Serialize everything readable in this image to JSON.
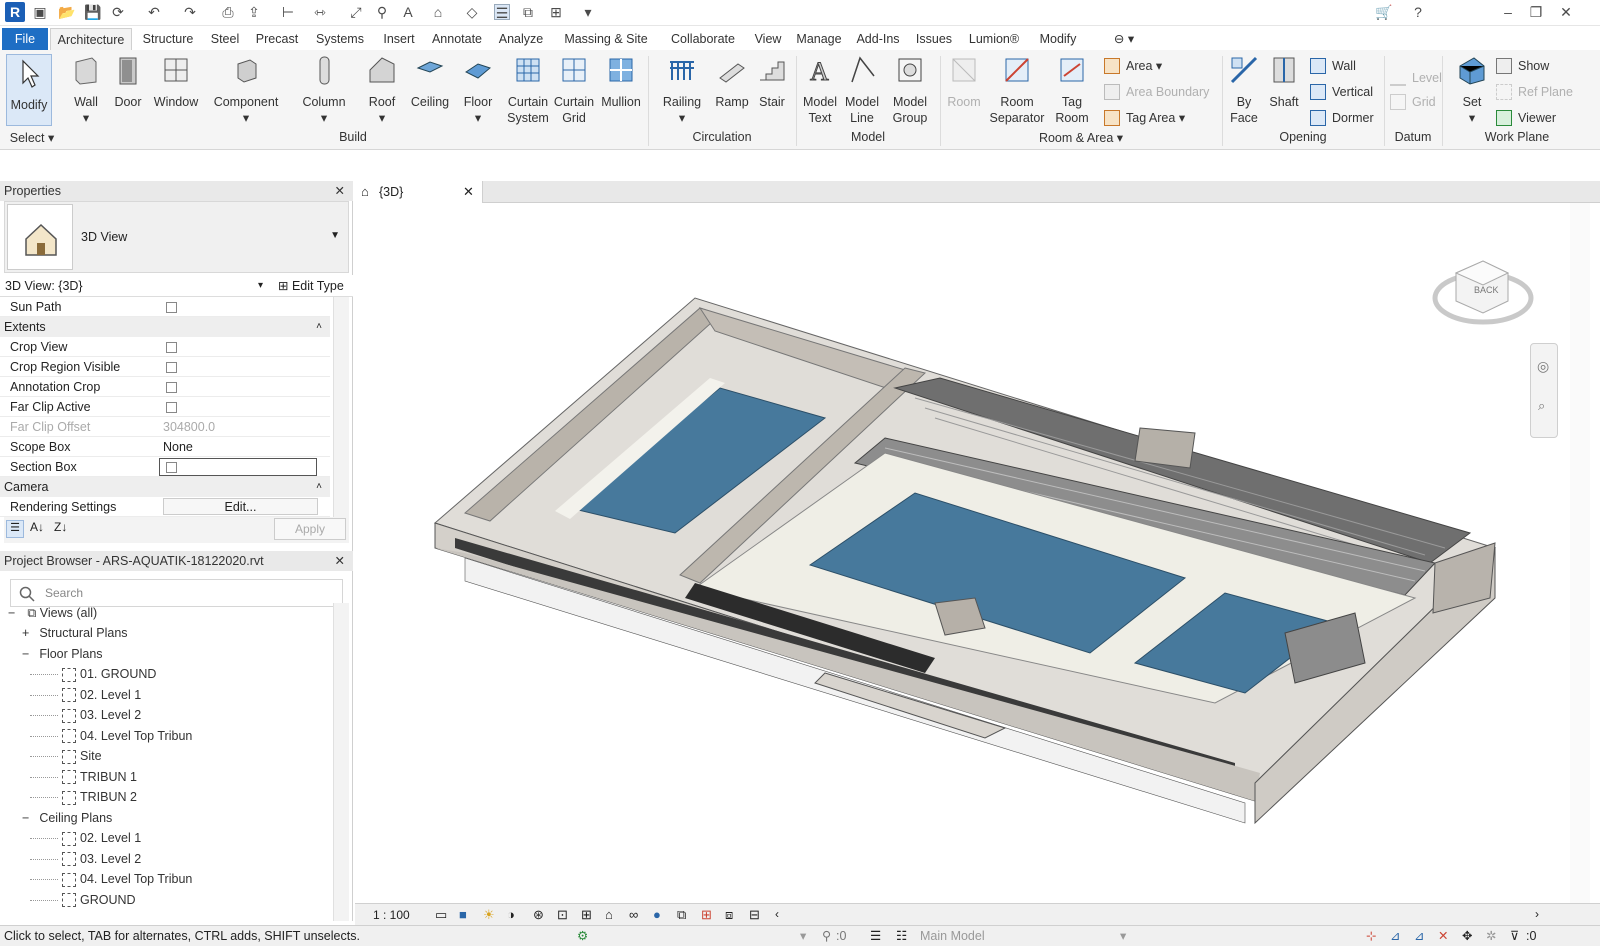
{
  "app": {
    "logo": "R"
  },
  "tabs": [
    "File",
    "Architecture",
    "Structure",
    "Steel",
    "Precast",
    "Systems",
    "Insert",
    "Annotate",
    "Analyze",
    "Massing & Site",
    "Collaborate",
    "View",
    "Manage",
    "Add-Ins",
    "Issues",
    "Lumion®",
    "Modify"
  ],
  "ribbon": {
    "modify": "Modify",
    "select": "Select",
    "wall": "Wall",
    "door": "Door",
    "window": "Window",
    "component": "Component",
    "column": "Column",
    "roof": "Roof",
    "ceiling": "Ceiling",
    "floor": "Floor",
    "curtain_system": [
      "Curtain",
      "System"
    ],
    "curtain_grid": [
      "Curtain",
      "Grid"
    ],
    "mullion": "Mullion",
    "railing": "Railing",
    "ramp": "Ramp",
    "stair": "Stair",
    "model_text": [
      "Model",
      "Text"
    ],
    "model_line": [
      "Model",
      "Line"
    ],
    "model_group": [
      "Model",
      "Group"
    ],
    "room": "Room",
    "room_separator": [
      "Room",
      "Separator"
    ],
    "tag_room": [
      "Tag",
      "Room"
    ],
    "area": "Area",
    "area_boundary": "Area  Boundary",
    "tag_area": "Tag  Area",
    "by_face": [
      "By",
      "Face"
    ],
    "shaft": "Shaft",
    "o_wall": "Wall",
    "vertical": "Vertical",
    "dormer": "Dormer",
    "level": "Level",
    "grid": "Grid",
    "set": "Set",
    "show": "Show",
    "ref_plane": "Ref  Plane",
    "viewer": "Viewer",
    "groups": {
      "build": "Build",
      "circulation": "Circulation",
      "model": "Model",
      "room_area": "Room & Area",
      "opening": "Opening",
      "datum": "Datum",
      "work_plane": "Work Plane"
    }
  },
  "properties": {
    "title": "Properties",
    "type": "3D View",
    "selector": "3D View: {3D}",
    "edit_type": "Edit Type",
    "rows": [
      {
        "label": "Sun Path",
        "kind": "cb"
      },
      {
        "label": "Extents",
        "kind": "cat"
      },
      {
        "label": "Crop View",
        "kind": "cb"
      },
      {
        "label": "Crop Region Visible",
        "kind": "cb"
      },
      {
        "label": "Annotation Crop",
        "kind": "cb"
      },
      {
        "label": "Far Clip Active",
        "kind": "cb"
      },
      {
        "label": "Far Clip Offset",
        "kind": "val",
        "value": "304800.0"
      },
      {
        "label": "Scope Box",
        "kind": "val",
        "value": "None"
      },
      {
        "label": "Section Box",
        "kind": "cb"
      },
      {
        "label": "Camera",
        "kind": "cat"
      },
      {
        "label": "Rendering Settings",
        "kind": "btn",
        "value": "Edit..."
      }
    ],
    "apply": "Apply"
  },
  "browser": {
    "title": "Project Browser - ARS-AQUATIK-18122020.rvt",
    "search_placeholder": "Search",
    "root": "Views (all)",
    "items": [
      {
        "label": "Structural Plans",
        "level": 1,
        "exp": "+"
      },
      {
        "label": "Floor Plans",
        "level": 1,
        "exp": "−"
      },
      {
        "label": "01. GROUND",
        "level": 2
      },
      {
        "label": "02. Level 1",
        "level": 2
      },
      {
        "label": "03. Level 2",
        "level": 2
      },
      {
        "label": "04. Level Top Tribun",
        "level": 2
      },
      {
        "label": "Site",
        "level": 2
      },
      {
        "label": "TRIBUN 1",
        "level": 2
      },
      {
        "label": "TRIBUN 2",
        "level": 2
      },
      {
        "label": "Ceiling Plans",
        "level": 1,
        "exp": "−"
      },
      {
        "label": "02. Level 1",
        "level": 2
      },
      {
        "label": "03. Level 2",
        "level": 2
      },
      {
        "label": "04. Level Top Tribun",
        "level": 2
      },
      {
        "label": "GROUND",
        "level": 2
      }
    ]
  },
  "view": {
    "tab": "{3D}",
    "scale": "1 : 100",
    "viewcube": "BACK"
  },
  "status": {
    "hint": "Click to select, TAB for alternates, CTRL adds, SHIFT unselects.",
    "zero1": ":0",
    "model": "Main Model",
    "zero2": ":0"
  }
}
